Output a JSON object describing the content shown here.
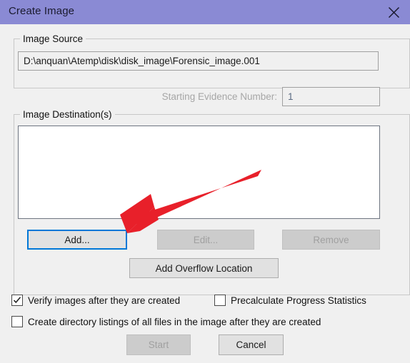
{
  "window": {
    "title": "Create Image",
    "close_icon": "close-icon",
    "titlebar_color": "#8a8ad4",
    "body_color": "#f0f0f0"
  },
  "image_source": {
    "legend": "Image Source",
    "path_value": "D:\\anquan\\Atemp\\disk\\disk_image\\Forensic_image.001",
    "path_placeholder": ""
  },
  "evidence": {
    "label": "Starting Evidence Number:",
    "value": "1",
    "disabled": true
  },
  "image_destinations": {
    "legend": "Image Destination(s)",
    "list_items": [],
    "buttons": {
      "add": "Add...",
      "edit": "Edit...",
      "remove": "Remove",
      "add_overflow": "Add Overflow Location"
    }
  },
  "options": [
    {
      "id": "verify",
      "label": "Verify images after they are created",
      "checked": true
    },
    {
      "id": "precalculate",
      "label": "Precalculate Progress Statistics",
      "checked": false
    },
    {
      "id": "directory_listings",
      "label": "Create directory listings of all files in the image after they are created",
      "checked": false
    }
  ],
  "footer": {
    "start": "Start",
    "cancel": "Cancel"
  },
  "annotation": {
    "type": "arrow",
    "color": "#e8202a",
    "points_to": "add-button"
  }
}
